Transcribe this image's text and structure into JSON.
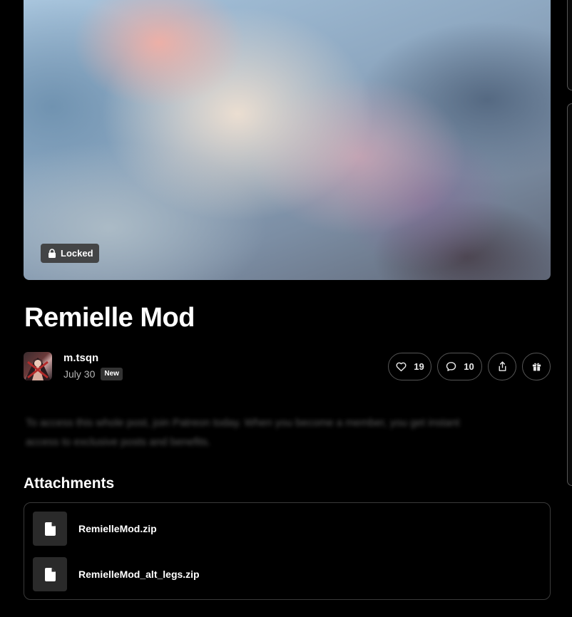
{
  "post": {
    "locked_label": "Locked",
    "title": "Remielle Mod",
    "author": "m.tsqn",
    "date": "July 30",
    "new_badge": "New",
    "likes": "19",
    "comments": "10",
    "blurred_teaser": [
      "To access this whole post, join Patreon today. When you become a member, you get instant",
      "access to exclusive posts and benefits."
    ]
  },
  "attachments": {
    "heading": "Attachments",
    "files": [
      {
        "name": "RemielleMod.zip"
      },
      {
        "name": "RemielleMod_alt_legs.zip"
      }
    ]
  },
  "icons": {
    "locked": "lock-icon",
    "like": "heart-icon",
    "comment": "speech-bubble-icon",
    "share": "share-icon",
    "gift": "gift-icon",
    "file": "file-icon"
  },
  "colors": {
    "background": "#000000",
    "pill_border": "#555555",
    "file_tile": "#2a2a2a",
    "badge_bg": "#333333"
  }
}
